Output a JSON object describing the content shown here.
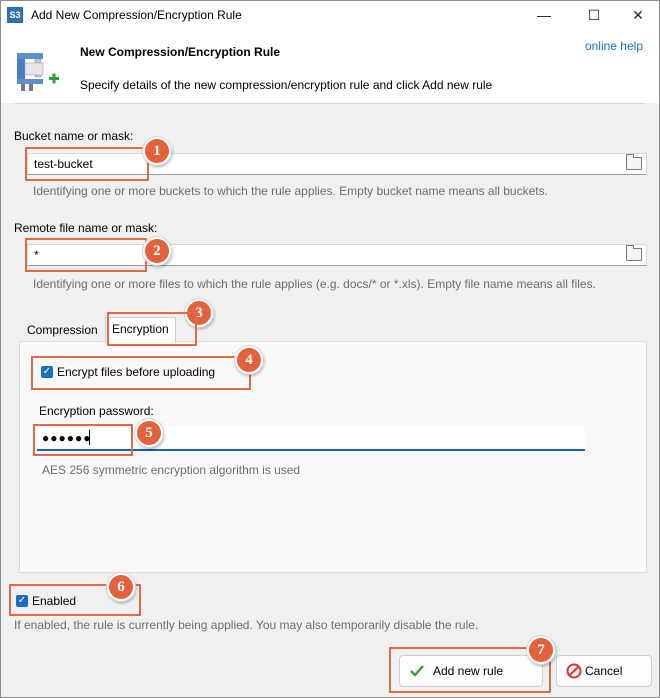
{
  "window": {
    "title": "Add New Compression/Encryption Rule",
    "app_icon_text": "S3",
    "controls": {
      "minimize": "—",
      "maximize": "☐",
      "close": "✕"
    }
  },
  "header": {
    "title": "New Compression/Encryption Rule",
    "subtitle": "Specify details of the new compression/encryption rule and click Add new rule",
    "help_link": "online help",
    "icon": "vise-compression-icon"
  },
  "bucket": {
    "label": "Bucket name or mask:",
    "value": "test-bucket",
    "hint": "Identifying one or more buckets to which the rule applies. Empty bucket name means all buckets."
  },
  "remote": {
    "label": "Remote file name or mask:",
    "value": "*",
    "hint": "Identifying one or more files to which the rule applies (e.g. docs/* or *.xls). Empty file name means all files."
  },
  "tabs": [
    {
      "label": "Compression",
      "active": false
    },
    {
      "label": "Encryption",
      "active": true
    }
  ],
  "encryption": {
    "checkbox_label": "Encrypt files before uploading",
    "checked": true,
    "password_label": "Encryption password:",
    "password_mask": "●●●●●●",
    "algorithm_note": "AES 256 symmetric encryption algorithm is used"
  },
  "enabled": {
    "label": "Enabled",
    "checked": true,
    "hint": "If enabled, the rule is currently being applied. You may also temporarily disable the rule."
  },
  "buttons": {
    "add": "Add new rule",
    "cancel": "Cancel"
  },
  "markers": [
    "1",
    "2",
    "3",
    "4",
    "5",
    "6",
    "7"
  ],
  "colors": {
    "accent": "#1a6fc4",
    "callout": "#e06a47",
    "marker": "#e3623b"
  }
}
